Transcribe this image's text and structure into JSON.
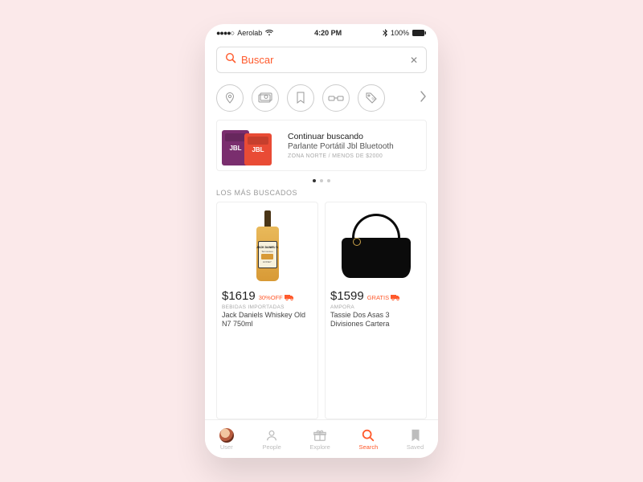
{
  "status": {
    "carrier": "Aerolab",
    "time": "4:20 PM",
    "battery": "100%"
  },
  "search": {
    "placeholder": "Buscar"
  },
  "categories": [
    {
      "name": "location"
    },
    {
      "name": "money"
    },
    {
      "name": "bookmark"
    },
    {
      "name": "glasses"
    },
    {
      "name": "tag"
    }
  ],
  "continue_card": {
    "title": "Continuar buscando",
    "product": "Parlante Portátil Jbl Bluetooth",
    "meta": "ZONA NORTE / MENOS DE $2000",
    "brand": "JBL"
  },
  "pagination": {
    "count": 3,
    "active": 0
  },
  "section_title": "LOS MÁS BUSCADOS",
  "products": [
    {
      "price": "$1619",
      "deal": "30%OFF",
      "category": "BEBIDAS IMPORTADAS",
      "name": "Jack Daniels Whiskey Old N7 750ml",
      "bottle_label_top": "JACK DANIEL'S",
      "bottle_label_mid": "Tennessee",
      "bottle_label_bottom": "HONEY"
    },
    {
      "price": "$1599",
      "deal": "GRATIS",
      "category": "AMPORA",
      "name": "Tassie Dos Asas 3 Divisiones Cartera"
    }
  ],
  "nav": [
    {
      "label": "User"
    },
    {
      "label": "People"
    },
    {
      "label": "Explore"
    },
    {
      "label": "Search"
    },
    {
      "label": "Saved"
    }
  ]
}
